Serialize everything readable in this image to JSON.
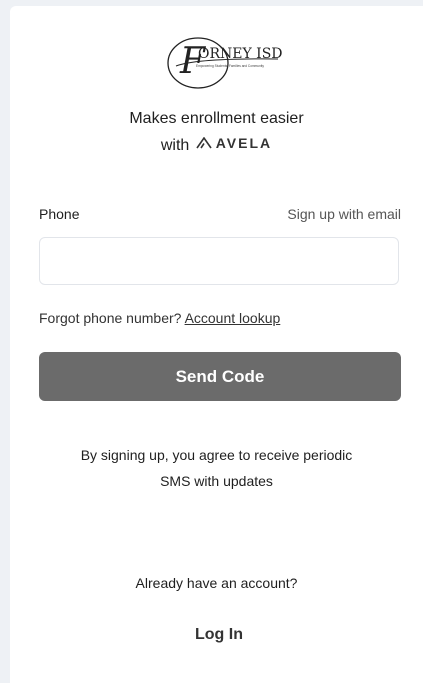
{
  "logo": {
    "text": "ORNEY ISD",
    "initial": "F",
    "subtext": "Empowering Students, Families and Community"
  },
  "tagline": {
    "line1": "Makes enrollment easier",
    "line2_prefix": "with",
    "brand": "AVELA"
  },
  "form": {
    "phone_label": "Phone",
    "email_link": "Sign up with email",
    "phone_value": "",
    "phone_placeholder": "",
    "forgot_text": "Forgot phone number?",
    "forgot_link": "Account lookup",
    "send_button": "Send Code"
  },
  "terms": {
    "line1": "By signing up, you agree to receive periodic",
    "line2": "SMS with updates"
  },
  "footer": {
    "already_text": "Already have an account?",
    "login_link": "Log In"
  }
}
